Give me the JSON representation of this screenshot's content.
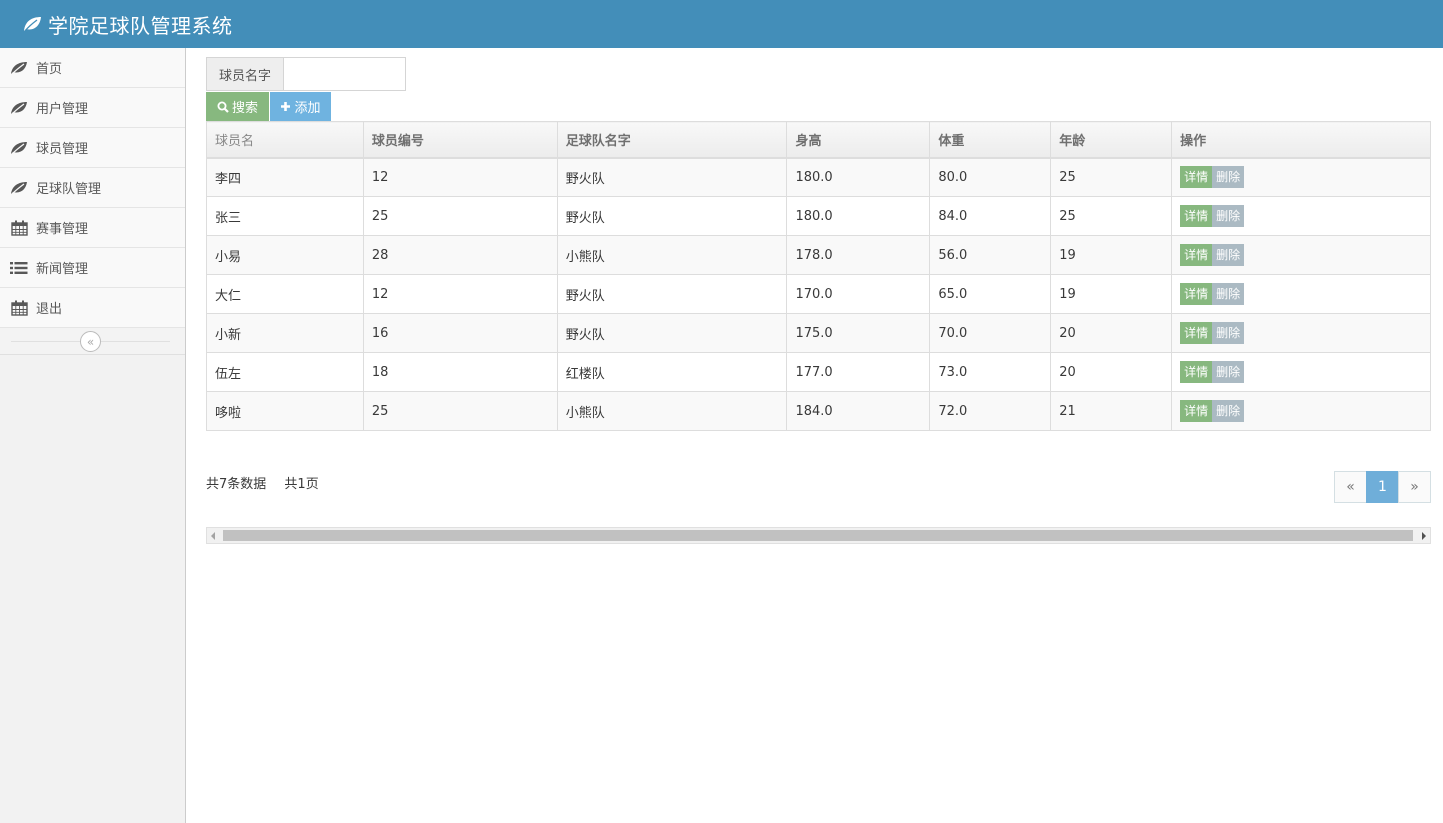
{
  "app": {
    "title": "学院足球队管理系统",
    "brand_icon": "leaf-icon"
  },
  "sidebar": {
    "items": [
      {
        "label": "首页",
        "icon": "leaf-icon"
      },
      {
        "label": "用户管理",
        "icon": "leaf-icon"
      },
      {
        "label": "球员管理",
        "icon": "leaf-icon"
      },
      {
        "label": "足球队管理",
        "icon": "leaf-icon"
      },
      {
        "label": "赛事管理",
        "icon": "calendar-icon"
      },
      {
        "label": "新闻管理",
        "icon": "list-icon"
      },
      {
        "label": "退出",
        "icon": "calendar-icon"
      }
    ],
    "collapse_icon": "double-chevron-left-icon"
  },
  "search": {
    "label": "球员名字",
    "value": "",
    "search_button": "搜索",
    "add_button": "添加"
  },
  "table": {
    "columns": [
      "球员名",
      "球员编号",
      "足球队名字",
      "身高",
      "体重",
      "年龄",
      "操作"
    ],
    "rows": [
      [
        "李四",
        "12",
        "野火队",
        "180.0",
        "80.0",
        "25"
      ],
      [
        "张三",
        "25",
        "野火队",
        "180.0",
        "84.0",
        "25"
      ],
      [
        "小易",
        "28",
        "小熊队",
        "178.0",
        "56.0",
        "19"
      ],
      [
        "大仁",
        "12",
        "野火队",
        "170.0",
        "65.0",
        "19"
      ],
      [
        "小新",
        "16",
        "野火队",
        "175.0",
        "70.0",
        "20"
      ],
      [
        "伍左",
        "18",
        "红楼队",
        "177.0",
        "73.0",
        "20"
      ],
      [
        "哆啦",
        "25",
        "小熊队",
        "184.0",
        "72.0",
        "21"
      ]
    ],
    "actions": {
      "detail": "详情",
      "delete": "删除"
    }
  },
  "footer": {
    "total_records": "共7条数据",
    "total_pages": "共1页",
    "pager": {
      "prev": "«",
      "current": "1",
      "next": "»"
    }
  },
  "colors": {
    "header": "#438eb9",
    "success": "#87b87f",
    "info": "#6fb3e0",
    "muted": "#abbac3",
    "active_page": "#6faed9"
  }
}
